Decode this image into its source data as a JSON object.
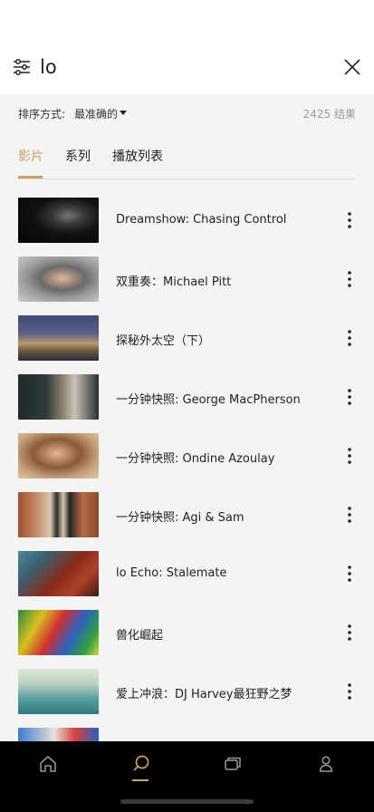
{
  "search": {
    "query": "lo"
  },
  "sort": {
    "label": "排序方式:",
    "value": "最准确的",
    "result_count": "2425 结果"
  },
  "tabs": [
    {
      "label": "影片",
      "active": true
    },
    {
      "label": "系列",
      "active": false
    },
    {
      "label": "播放列表",
      "active": false
    }
  ],
  "results": [
    {
      "title": "Dreamshow: Chasing Control",
      "thumb": "dark-portrait"
    },
    {
      "title": "双重奏：Michael Pitt",
      "thumb": "street-portrait"
    },
    {
      "title": "探秘外太空（下）",
      "thumb": "city-skyline"
    },
    {
      "title": "一分钟快照: George MacPherson",
      "thumb": "man-in-suit"
    },
    {
      "title": "一分钟快照: Ondine Azoulay",
      "thumb": "woman-curly-hair"
    },
    {
      "title": "一分钟快照: Agi & Sam",
      "thumb": "street-walkers"
    },
    {
      "title": "lo Echo: Stalemate",
      "thumb": "red-blur"
    },
    {
      "title": "兽化崛起",
      "thumb": "animation"
    },
    {
      "title": "爱上冲浪：DJ Harvey最狂野之梦",
      "thumb": "surfer"
    },
    {
      "title": "",
      "thumb": "comic-partial"
    }
  ],
  "nav": [
    {
      "name": "home",
      "icon": "home-icon",
      "active": false
    },
    {
      "name": "search",
      "icon": "search-icon",
      "active": true
    },
    {
      "name": "library",
      "icon": "library-icon",
      "active": false
    },
    {
      "name": "profile",
      "icon": "profile-icon",
      "active": false
    }
  ],
  "colors": {
    "accent": "#c7a36b",
    "nav_bg": "#000000",
    "page_bg": "#f4f4f4"
  }
}
